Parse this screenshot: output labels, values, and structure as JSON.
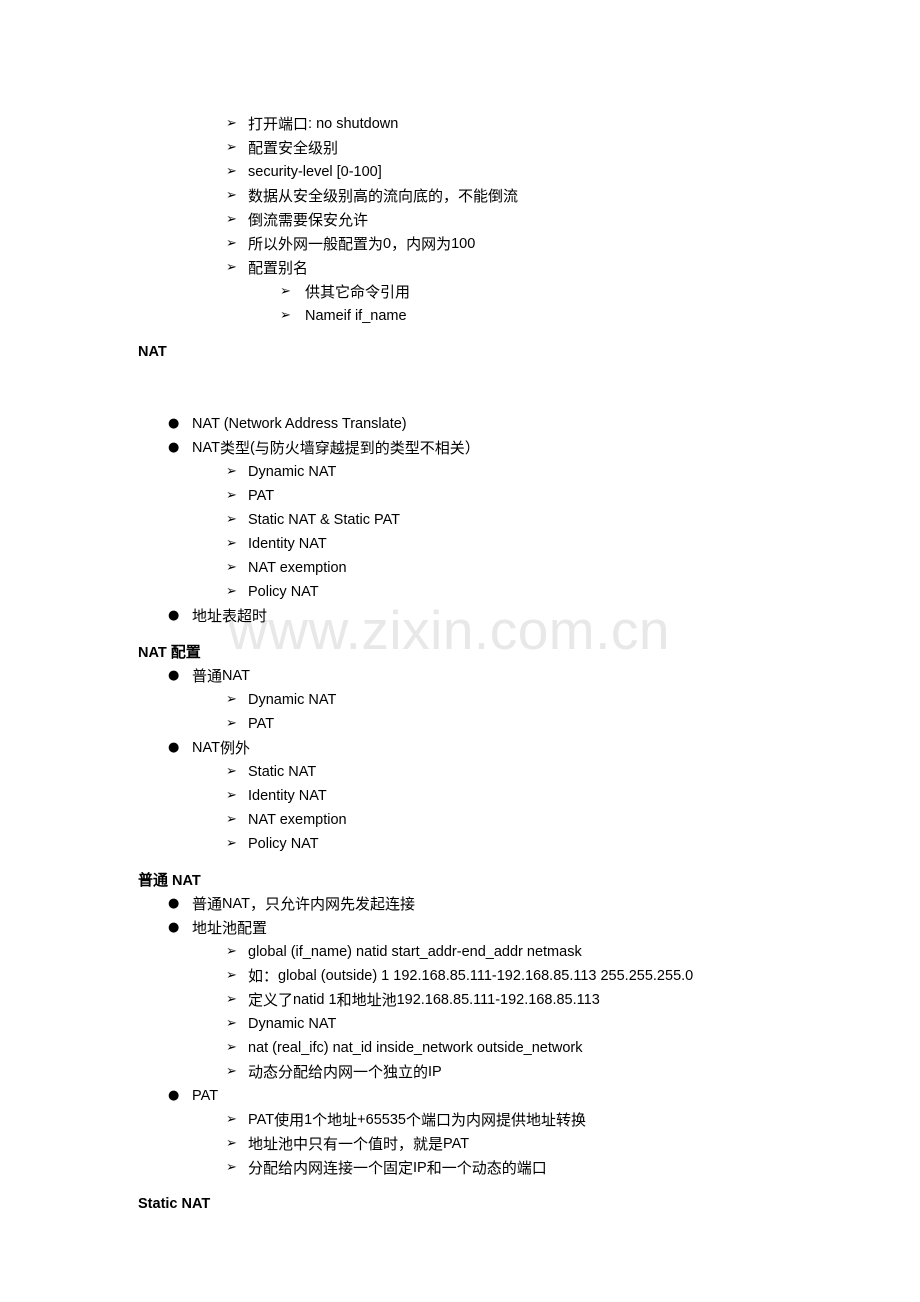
{
  "document": {
    "watermark": "www.zixin.com.cn",
    "bullet_glyphs": {
      "disc": "●",
      "arrow": "➢"
    },
    "colors": {
      "text": "#000000",
      "background": "#ffffff",
      "watermark": "#e8e8e8"
    },
    "blocks": [
      {
        "type": "list",
        "items": [
          {
            "level": 2,
            "marker": "arrow",
            "text": "打开端口: no shutdown"
          },
          {
            "level": 2,
            "marker": "arrow",
            "text": "配置安全级别"
          },
          {
            "level": 2,
            "marker": "arrow",
            "text": "security-level [0-100]"
          },
          {
            "level": 2,
            "marker": "arrow",
            "text": "数据从安全级别高的流向底的，不能倒流"
          },
          {
            "level": 2,
            "marker": "arrow",
            "text": "倒流需要保安允许"
          },
          {
            "level": 2,
            "marker": "arrow",
            "text": "所以外网一般配置为 0，内网为 100"
          },
          {
            "level": 2,
            "marker": "arrow",
            "text": "配置别名"
          },
          {
            "level": 3,
            "marker": "arrow",
            "text": "供其它命令引用"
          },
          {
            "level": 3,
            "marker": "arrow",
            "text": "Nameif if_name"
          }
        ]
      },
      {
        "type": "heading",
        "text": "NAT"
      },
      {
        "type": "list",
        "items": [
          {
            "level": 1,
            "marker": "disc",
            "text": "NAT (Network Address Translate)"
          },
          {
            "level": 1,
            "marker": "disc",
            "text": "NAT 类型(与防火墙穿越提到的类型不相关）"
          },
          {
            "level": 2,
            "marker": "arrow",
            "text": "Dynamic NAT"
          },
          {
            "level": 2,
            "marker": "arrow",
            "text": "PAT"
          },
          {
            "level": 2,
            "marker": "arrow",
            "text": "Static NAT & Static PAT"
          },
          {
            "level": 2,
            "marker": "arrow",
            "text": "Identity NAT"
          },
          {
            "level": 2,
            "marker": "arrow",
            "text": "NAT exemption"
          },
          {
            "level": 2,
            "marker": "arrow",
            "text": "Policy NAT"
          },
          {
            "level": 1,
            "marker": "disc",
            "text": "地址表超时"
          }
        ]
      },
      {
        "type": "heading",
        "text": "NAT 配置"
      },
      {
        "type": "list",
        "items": [
          {
            "level": 1,
            "marker": "disc",
            "text": "普通 NAT"
          },
          {
            "level": 2,
            "marker": "arrow",
            "text": "Dynamic NAT"
          },
          {
            "level": 2,
            "marker": "arrow",
            "text": "PAT"
          },
          {
            "level": 1,
            "marker": "disc",
            "text": "NAT 例外"
          },
          {
            "level": 2,
            "marker": "arrow",
            "text": "Static NAT"
          },
          {
            "level": 2,
            "marker": "arrow",
            "text": "Identity NAT"
          },
          {
            "level": 2,
            "marker": "arrow",
            "text": "NAT exemption"
          },
          {
            "level": 2,
            "marker": "arrow",
            "text": "Policy NAT"
          }
        ]
      },
      {
        "type": "heading",
        "text": "普通 NAT"
      },
      {
        "type": "list",
        "items": [
          {
            "level": 1,
            "marker": "disc",
            "text": "普通 NAT，只允许内网先发起连接"
          },
          {
            "level": 1,
            "marker": "disc",
            "text": "地址池配置"
          },
          {
            "level": 2,
            "marker": "arrow",
            "text": "global (if_name) natid start_addr-end_addr netmask"
          },
          {
            "level": 2,
            "marker": "arrow",
            "text": "如： global (outside) 1 192.168.85.111-192.168.85.113 255.255.255.0"
          },
          {
            "level": 2,
            "marker": "arrow",
            "text": "定义了 natid 1  和地址池  192.168.85.111-192.168.85.113"
          },
          {
            "level": 2,
            "marker": "arrow",
            "text": "Dynamic NAT"
          },
          {
            "level": 2,
            "marker": "arrow",
            "text": "nat (real_ifc) nat_id inside_network outside_network"
          },
          {
            "level": 2,
            "marker": "arrow",
            "text": "动态分配给内网一个独立的 IP"
          },
          {
            "level": 1,
            "marker": "disc",
            "text": "PAT"
          },
          {
            "level": 2,
            "marker": "arrow",
            "text": "PAT 使用 1 个地址+65535 个端口为内网提供地址转换"
          },
          {
            "level": 2,
            "marker": "arrow",
            "text": "地址池中只有一个值时，就是 PAT"
          },
          {
            "level": 2,
            "marker": "arrow",
            "text": "分配给内网连接一个固定 IP 和一个动态的端口"
          }
        ]
      },
      {
        "type": "heading",
        "text": "Static NAT"
      }
    ]
  }
}
